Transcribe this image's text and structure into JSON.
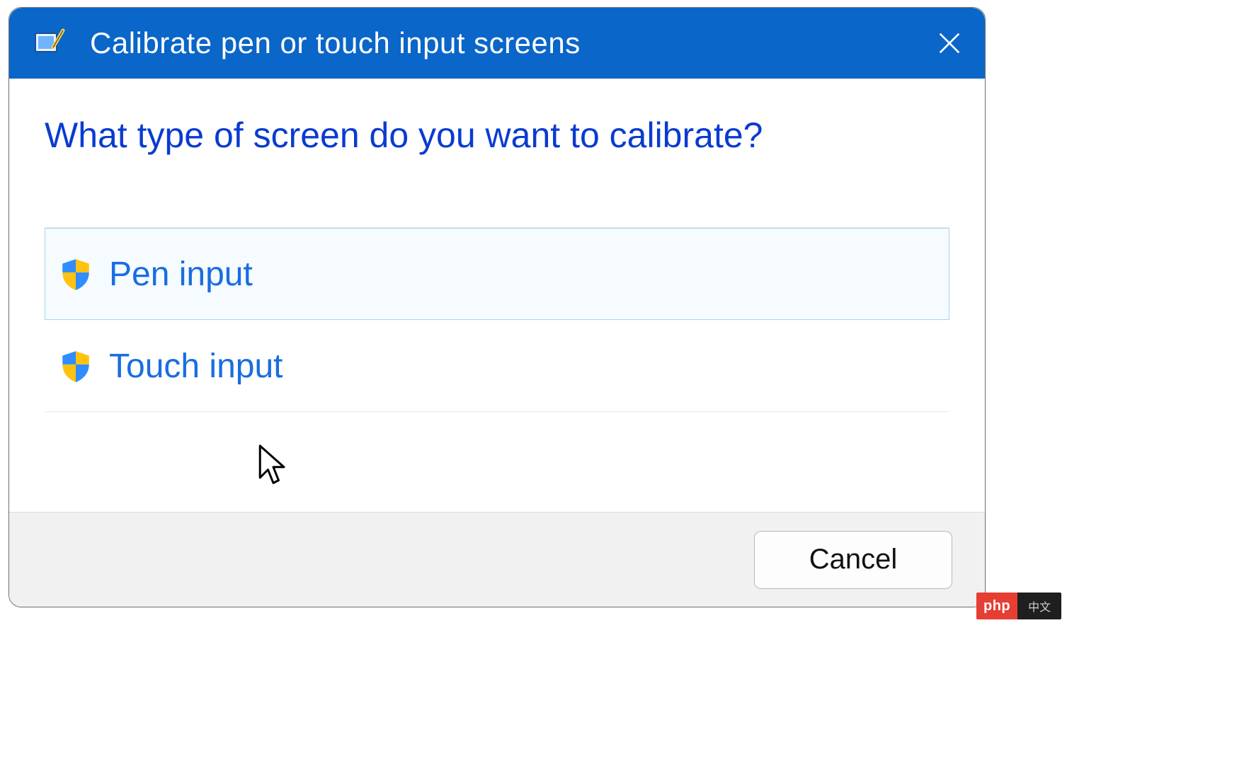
{
  "titlebar": {
    "title": "Calibrate pen or touch input screens",
    "icon": "tablet-calibration-icon",
    "close_icon": "close-icon"
  },
  "heading": "What type of screen do you want to calibrate?",
  "options": [
    {
      "label": "Pen input",
      "icon": "uac-shield-icon",
      "selected": true
    },
    {
      "label": "Touch input",
      "icon": "uac-shield-icon",
      "selected": false
    }
  ],
  "footer": {
    "cancel_label": "Cancel"
  },
  "badge": {
    "left": "php",
    "right": "中文"
  },
  "colors": {
    "titlebar_bg": "#0a66c8",
    "heading_color": "#0a3bd1",
    "link_color": "#196de0",
    "footer_bg": "#f1f1f1"
  }
}
